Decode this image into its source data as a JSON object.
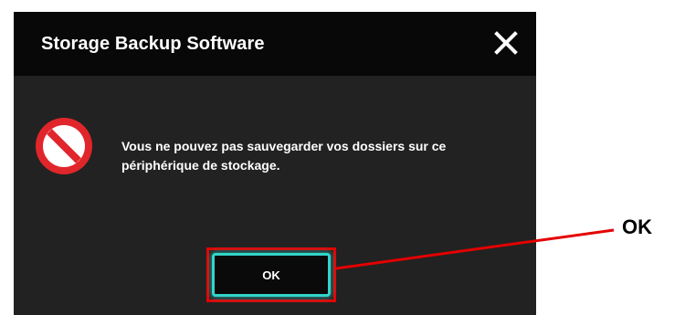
{
  "dialog": {
    "title": "Storage Backup Software",
    "close_icon": "close-icon",
    "status_icon": "prohibited-icon",
    "message": "Vous ne pouvez pas sauvegarder vos dossiers sur ce périphérique de stockage.",
    "ok_label": "OK"
  },
  "annotation": {
    "label": "OK",
    "color": "#e40000"
  },
  "colors": {
    "dialog_bg": "#222222",
    "titlebar_bg": "#080808",
    "button_border": "#33d4c9",
    "icon_red": "#e0262b"
  }
}
